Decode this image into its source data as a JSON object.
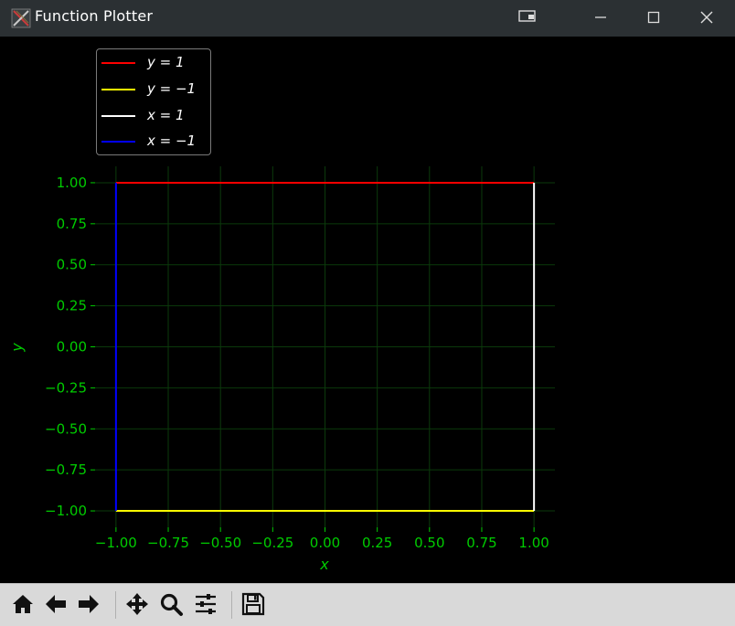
{
  "window": {
    "title": "Function Plotter"
  },
  "colors": {
    "titlebar": "#2b3033",
    "axis_text": "#00cc00",
    "grid": "#0b3a0b",
    "toolbar": "#d9d9d9"
  },
  "legend": {
    "entries": [
      {
        "label": "y = 1",
        "color": "#ff0000"
      },
      {
        "label": "y = −1",
        "color": "#ffff00"
      },
      {
        "label": "x = 1",
        "color": "#ffffff"
      },
      {
        "label": "x = −1",
        "color": "#0000ff"
      }
    ]
  },
  "chart_data": {
    "type": "line",
    "xlabel": "x",
    "ylabel": "y",
    "xlim": [
      -1.1,
      1.1
    ],
    "ylim": [
      -1.1,
      1.1
    ],
    "grid": true,
    "legend_position": "above-top-left",
    "xticks": [
      -1.0,
      -0.75,
      -0.5,
      -0.25,
      0.0,
      0.25,
      0.5,
      0.75,
      1.0
    ],
    "yticks": [
      1.0,
      0.75,
      0.5,
      0.25,
      0.0,
      -0.25,
      -0.5,
      -0.75,
      -1.0
    ],
    "xtick_labels": [
      "−1.00",
      "−0.75",
      "−0.50",
      "−0.25",
      "0.00",
      "0.25",
      "0.50",
      "0.75",
      "1.00"
    ],
    "ytick_labels": [
      "1.00",
      "0.75",
      "0.50",
      "0.25",
      "0.00",
      "−0.25",
      "−0.50",
      "−0.75",
      "−1.00"
    ],
    "series": [
      {
        "name": "y = 1",
        "color": "#ff0000",
        "x": [
          -1.0,
          1.0
        ],
        "y": [
          1.0,
          1.0
        ]
      },
      {
        "name": "y = −1",
        "color": "#ffff00",
        "x": [
          -1.0,
          1.0
        ],
        "y": [
          -1.0,
          -1.0
        ]
      },
      {
        "name": "x = 1",
        "color": "#ffffff",
        "x": [
          1.0,
          1.0
        ],
        "y": [
          -1.0,
          1.0
        ]
      },
      {
        "name": "x = −1",
        "color": "#0000ff",
        "x": [
          -1.0,
          -1.0
        ],
        "y": [
          -1.0,
          1.0
        ]
      }
    ]
  },
  "toolbar": {
    "tools": [
      {
        "name": "home",
        "icon": "home-icon"
      },
      {
        "name": "back",
        "icon": "arrow-left-icon"
      },
      {
        "name": "forward",
        "icon": "arrow-right-icon"
      },
      {
        "name": "pan",
        "icon": "move-icon"
      },
      {
        "name": "zoom",
        "icon": "magnifier-icon"
      },
      {
        "name": "configure-subplots",
        "icon": "sliders-icon"
      },
      {
        "name": "save",
        "icon": "floppy-disk-icon"
      }
    ]
  }
}
